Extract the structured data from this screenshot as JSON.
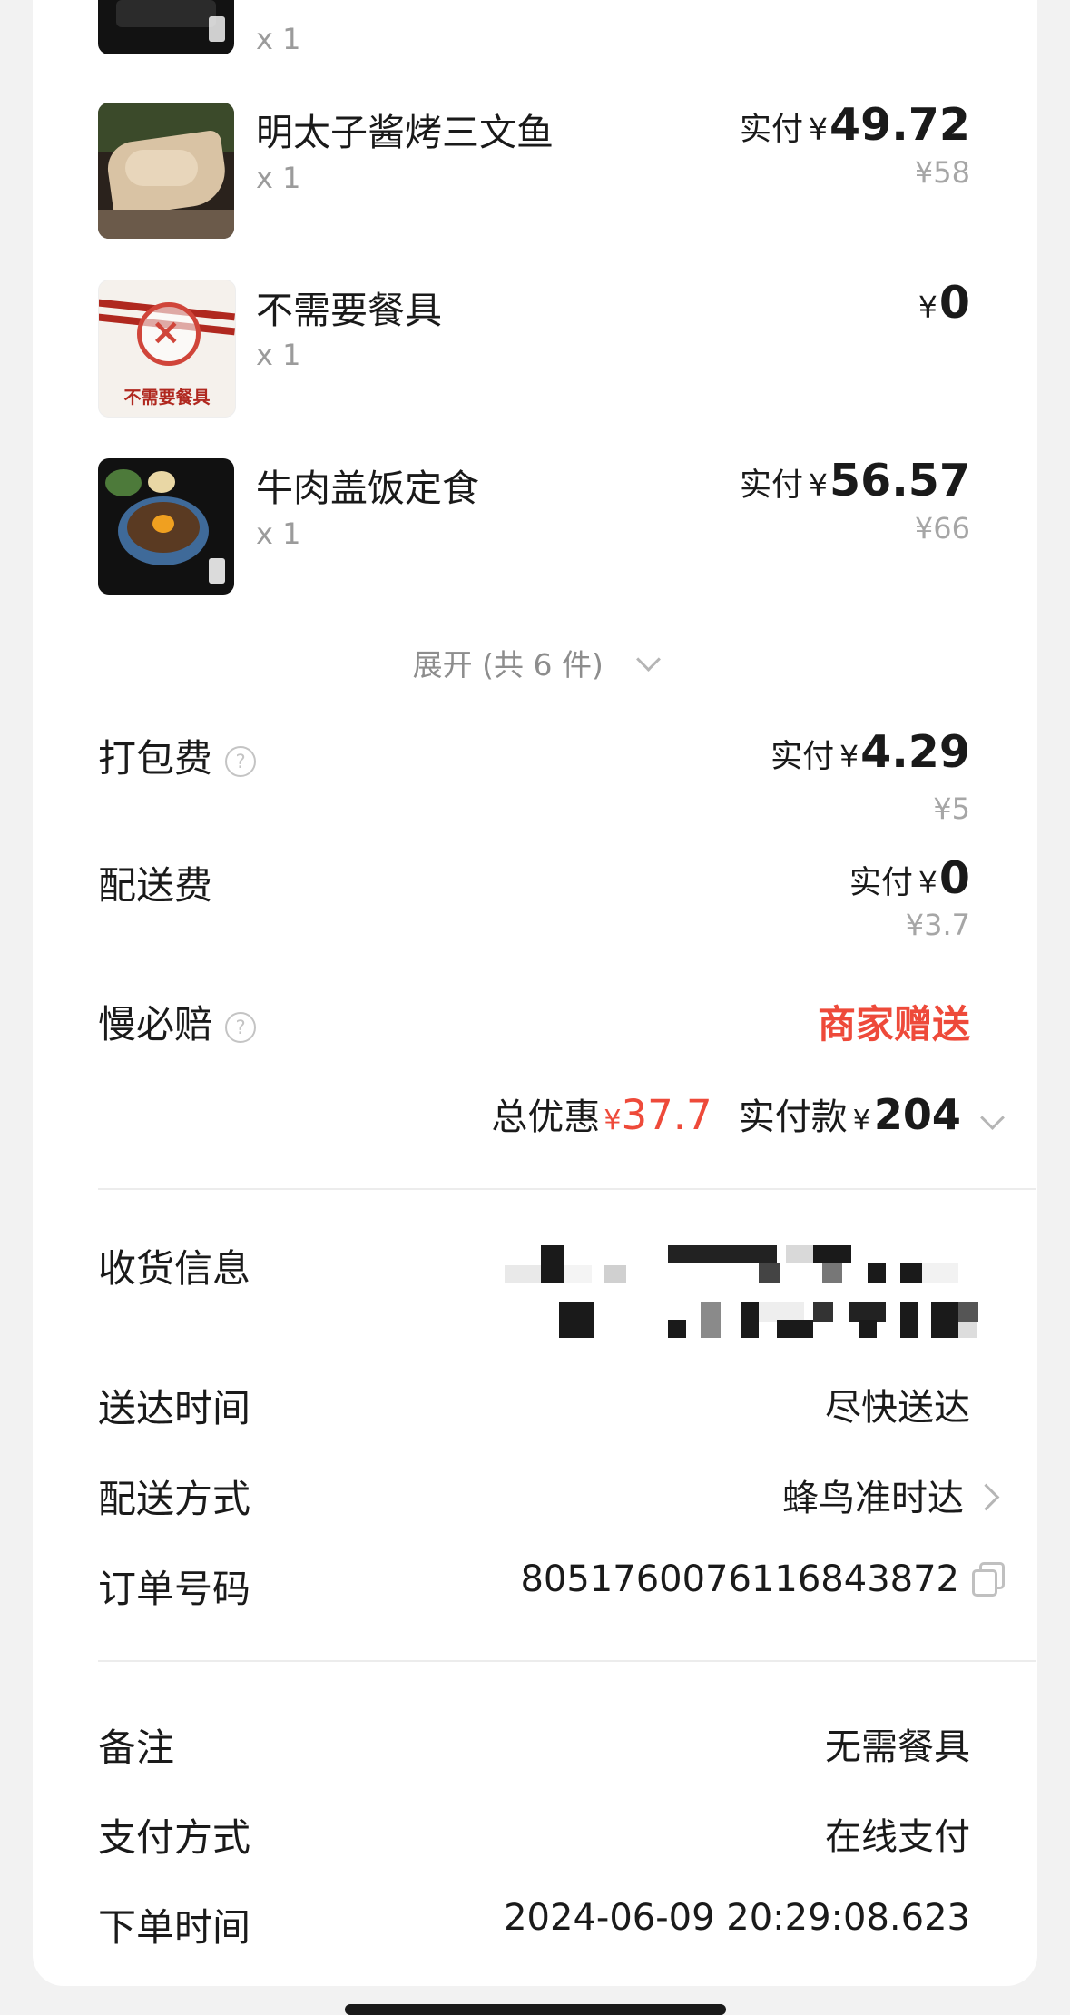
{
  "items": [
    {
      "name": "",
      "qty": "x 1"
    },
    {
      "name": "明太子酱烤三文鱼",
      "qty": "x 1",
      "price_label": "实付",
      "currency": "¥",
      "price": "49.72",
      "original": "¥58"
    },
    {
      "name": "不需要餐具",
      "qty": "x 1",
      "currency": "¥",
      "price": "0",
      "image_caption": "不需要餐具"
    },
    {
      "name": "牛肉盖饭定食",
      "qty": "x 1",
      "price_label": "实付",
      "currency": "¥",
      "price": "56.57",
      "original": "¥66"
    }
  ],
  "expand_label": "展开 (共 6 件)",
  "fees": {
    "packing": {
      "label": "打包费",
      "paid_label": "实付",
      "currency": "¥",
      "value": "4.29",
      "original": "¥5"
    },
    "delivery": {
      "label": "配送费",
      "paid_label": "实付",
      "currency": "¥",
      "value": "0",
      "original": "¥3.7"
    },
    "late_comp": {
      "label": "慢必赔",
      "value": "商家赠送"
    }
  },
  "summary": {
    "discount_label": "总优惠",
    "discount_currency": "¥",
    "discount_value": "37.7",
    "paid_label": "实付款",
    "paid_currency": "¥",
    "paid_value": "204"
  },
  "info": {
    "receiver_label": "收货信息",
    "arrival_label": "送达时间",
    "arrival_value": "尽快送达",
    "method_label": "配送方式",
    "method_value": "蜂鸟准时达",
    "order_label": "订单号码",
    "order_value": "8051760076116843872",
    "note_label": "备注",
    "note_value": "无需餐具",
    "pay_label": "支付方式",
    "pay_value": "在线支付",
    "time_label": "下单时间",
    "time_value": "2024-06-09 20:29:08.623"
  },
  "colors": {
    "accent_red": "#ee4a3a",
    "muted": "#9b9b9b"
  },
  "icons": {
    "help": "help-circle-icon",
    "chevron": "chevron-down-icon",
    "arrow": "chevron-right-icon",
    "copy": "copy-icon"
  }
}
